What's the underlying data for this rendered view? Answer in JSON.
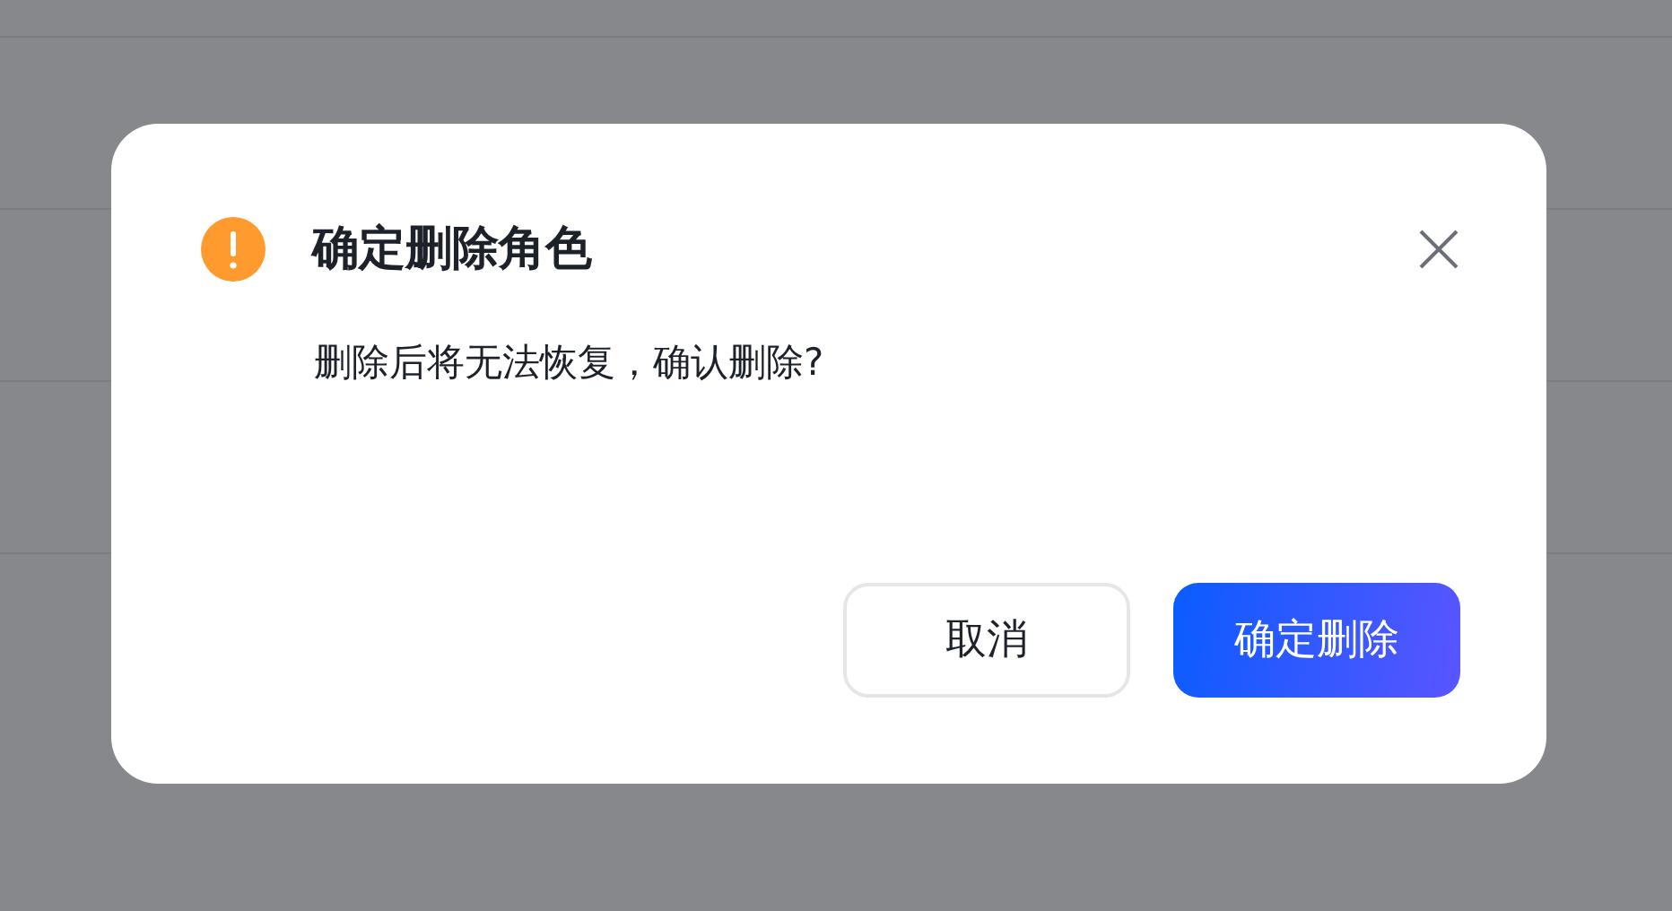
{
  "dialog": {
    "title": "确定删除角色",
    "message": "删除后将无法恢复，确认删除?",
    "buttons": [
      {
        "label": "取消",
        "kind": "secondary"
      },
      {
        "label": "确定删除",
        "kind": "primary"
      }
    ]
  }
}
